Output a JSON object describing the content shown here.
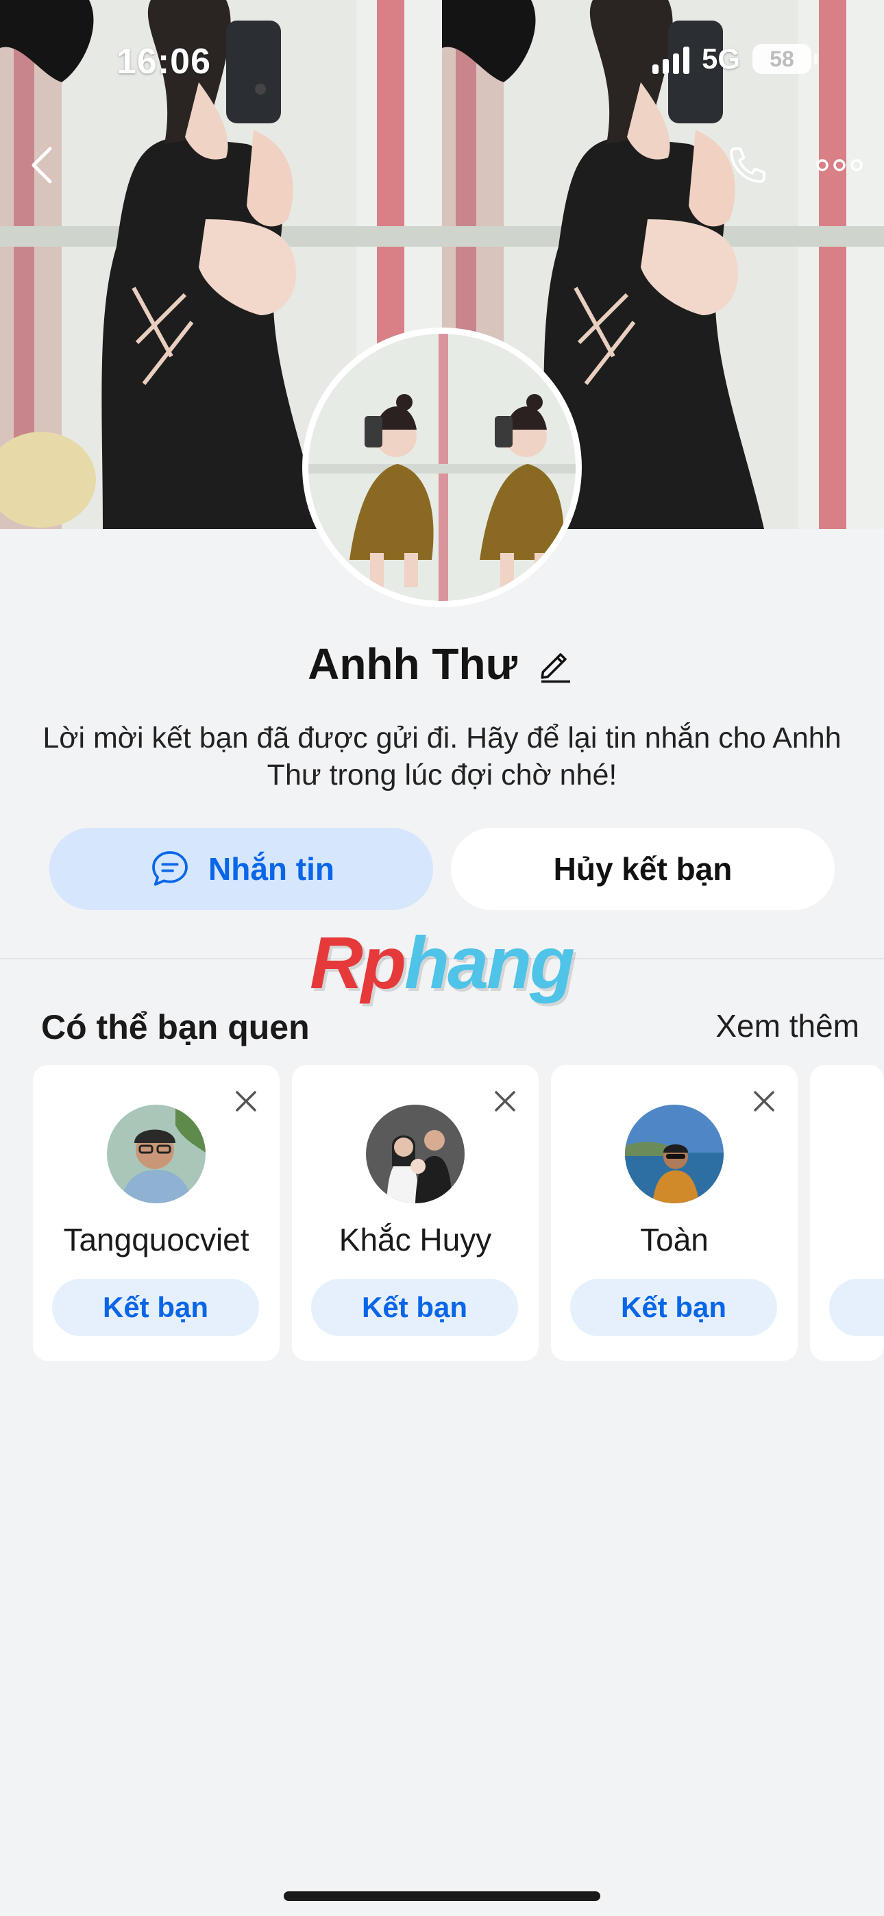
{
  "status_bar": {
    "time": "16:06",
    "network": "5G",
    "battery": "58"
  },
  "header": {
    "back_icon": "chevron-left-icon",
    "call_icon": "phone-icon",
    "more_icon": "more-horizontal-icon"
  },
  "profile": {
    "name": "Anhh Thư",
    "edit_icon": "pencil-icon",
    "invite_message": "Lời mời kết bạn đã được gửi đi. Hãy để lại tin nhắn cho Anhh Thư trong lúc đợi chờ nhé!"
  },
  "actions": {
    "message_label": "Nhắn tin",
    "message_icon": "chat-bubble-icon",
    "cancel_label": "Hủy kết bạn"
  },
  "watermark": {
    "part_a": "Rp",
    "part_b": "hang"
  },
  "suggestions": {
    "title": "Có thể bạn quen",
    "see_more": "Xem thêm",
    "items": [
      {
        "name": "Tangquocviet",
        "button": "Kết bạn"
      },
      {
        "name": "Khắc Huyy",
        "button": "Kết bạn"
      },
      {
        "name": "Toàn",
        "button": "Kết bạn"
      }
    ]
  },
  "colors": {
    "accent": "#0a66e8",
    "accent_bg": "#d5e6fd",
    "page_bg": "#f2f3f5"
  }
}
